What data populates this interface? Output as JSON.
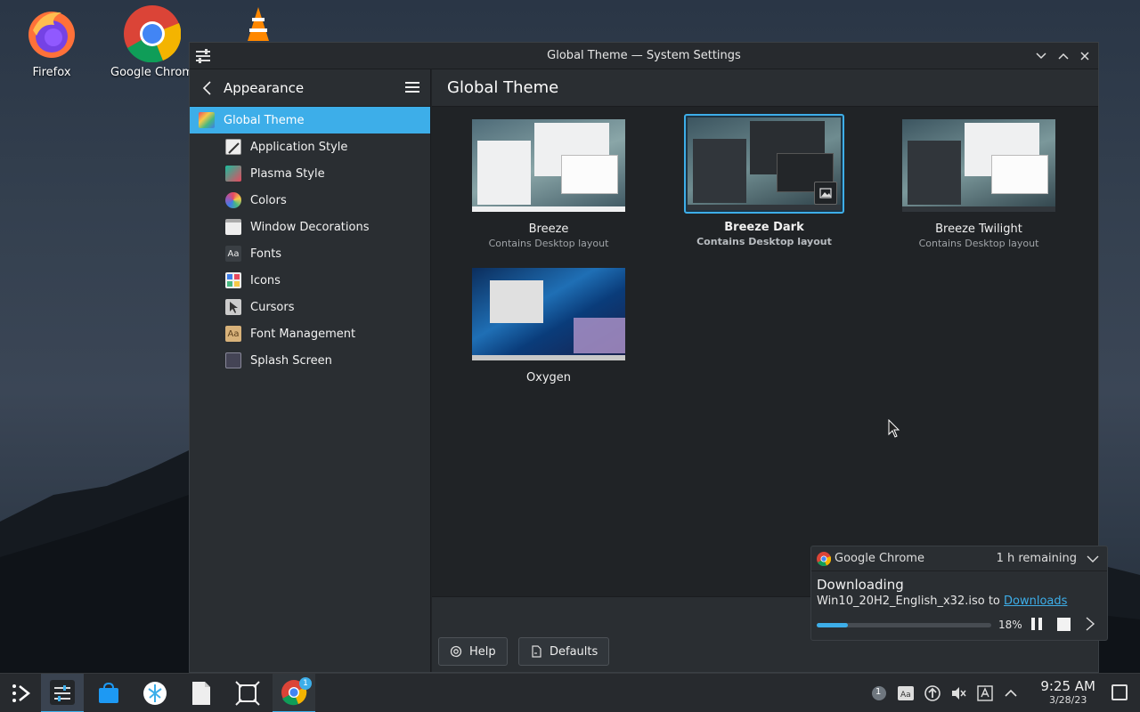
{
  "desktop": {
    "icons": [
      {
        "label": "Firefox",
        "icon": "firefox-icon"
      },
      {
        "label": "Google Chrome",
        "icon": "chrome-icon"
      },
      {
        "label": "VLC",
        "icon": "vlc-icon"
      }
    ]
  },
  "window": {
    "title": "Global Theme — System Settings",
    "controls": [
      "minimize",
      "maximize",
      "close"
    ]
  },
  "sidebar": {
    "header": "Appearance",
    "items": [
      {
        "label": "Global Theme",
        "active": true
      },
      {
        "label": "Application Style"
      },
      {
        "label": "Plasma Style"
      },
      {
        "label": "Colors"
      },
      {
        "label": "Window Decorations"
      },
      {
        "label": "Fonts"
      },
      {
        "label": "Icons"
      },
      {
        "label": "Cursors"
      },
      {
        "label": "Font Management"
      },
      {
        "label": "Splash Screen"
      }
    ]
  },
  "content": {
    "title": "Global Theme",
    "themes": [
      {
        "name": "Breeze",
        "subtitle": "Contains Desktop layout",
        "selected": false
      },
      {
        "name": "Breeze Dark",
        "subtitle": "Contains Desktop layout",
        "selected": true
      },
      {
        "name": "Breeze Twilight",
        "subtitle": "Contains Desktop layout",
        "selected": false
      },
      {
        "name": "Oxygen",
        "subtitle": "",
        "selected": false
      }
    ],
    "footer": {
      "help_label": "Help",
      "defaults_label": "Defaults"
    }
  },
  "notification": {
    "app": "Google Chrome",
    "remaining": "1 h remaining",
    "title": "Downloading",
    "file": "Win10_20H2_English_x32.iso to ",
    "link": "Downloads",
    "progress_percent": 18,
    "progress_label": "18%"
  },
  "taskbar": {
    "time": "9:25 AM",
    "date": "3/28/23",
    "chrome_badge": "1",
    "updates_badge": "1"
  },
  "colors": {
    "accent": "#3daee9",
    "window_bg": "#202326",
    "sidebar_bg": "#2a2e32"
  }
}
